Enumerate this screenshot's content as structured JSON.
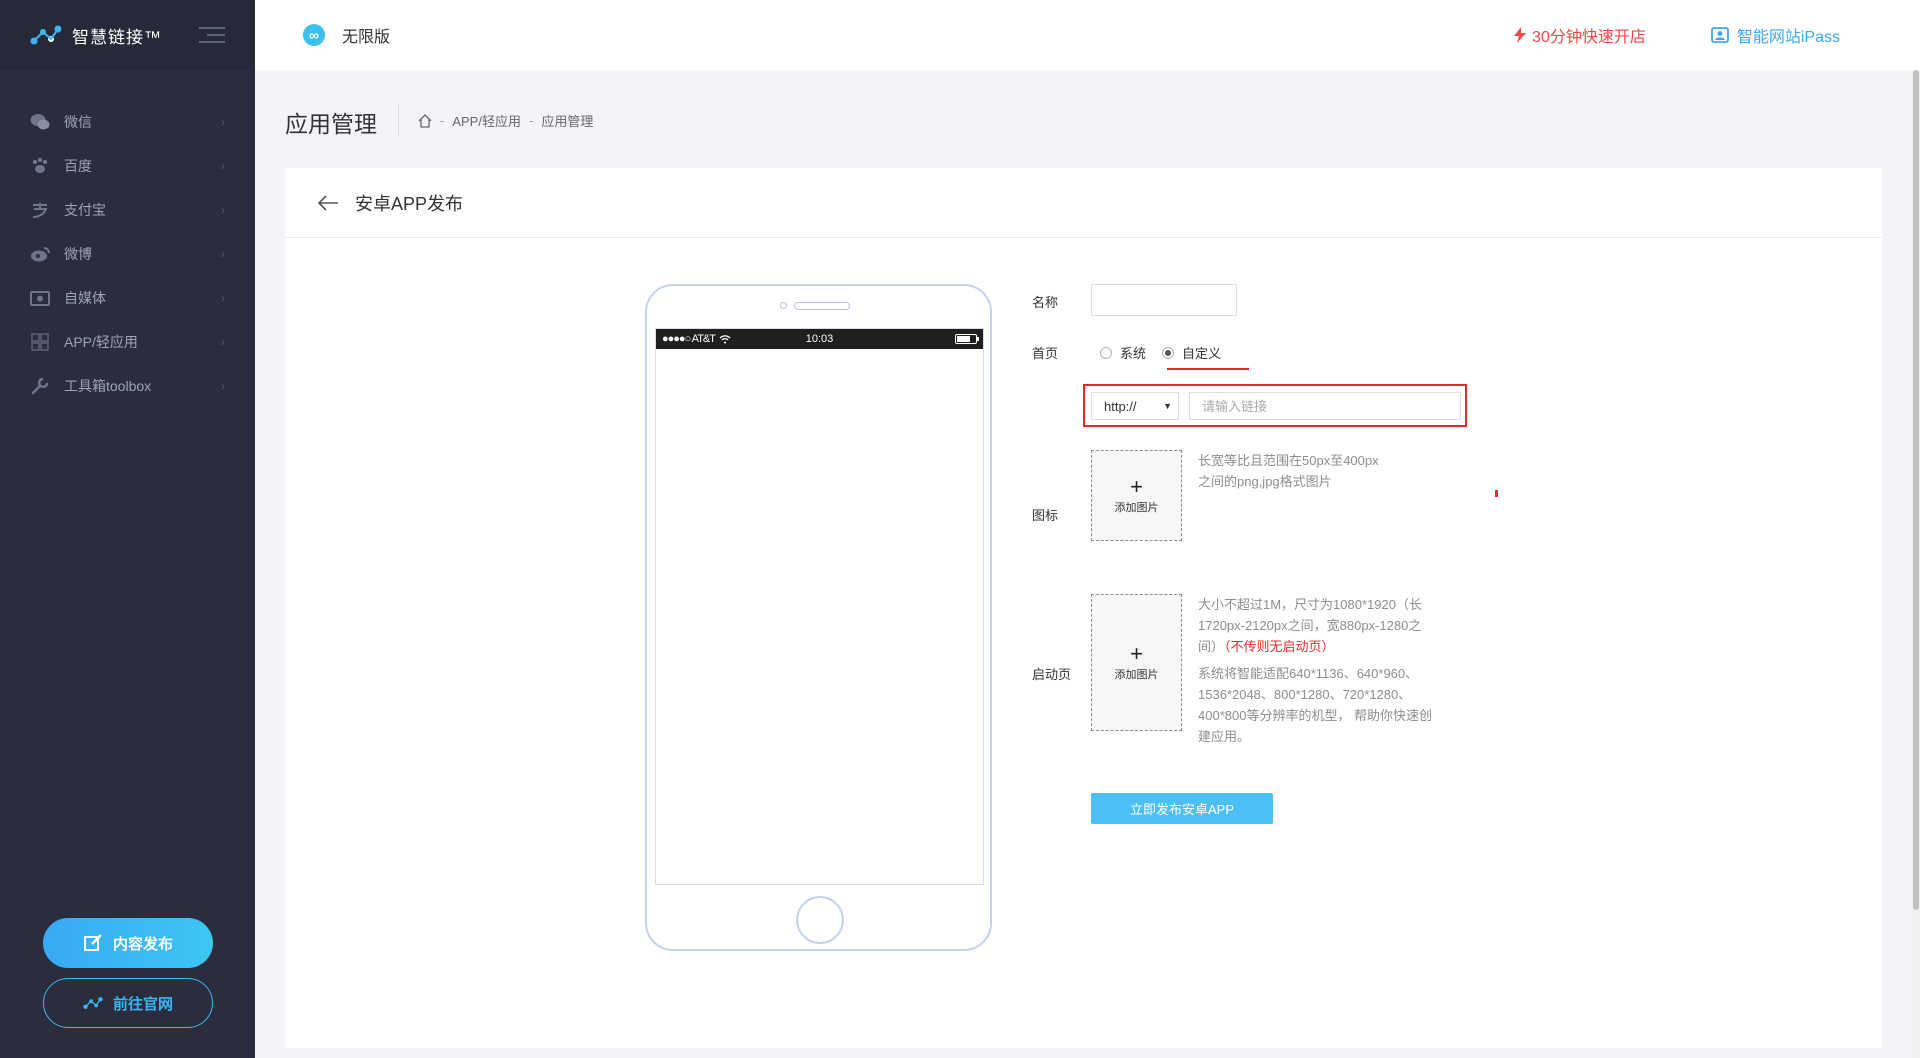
{
  "brand": {
    "name": "智慧链接™"
  },
  "sidebar": {
    "items": [
      {
        "label": "微信",
        "icon": "wechat-icon"
      },
      {
        "label": "百度",
        "icon": "paw-icon"
      },
      {
        "label": "支付宝",
        "icon": "alipay-icon"
      },
      {
        "label": "微博",
        "icon": "weibo-icon"
      },
      {
        "label": "自媒体",
        "icon": "media-icon"
      },
      {
        "label": "APP/轻应用",
        "icon": "app-grid-icon"
      },
      {
        "label": "工具箱toolbox",
        "icon": "wrench-icon"
      }
    ],
    "publish_button": "内容发布",
    "official_button": "前往官网"
  },
  "topbar": {
    "edition": "无限版",
    "promo": "30分钟快速开店",
    "ipass": "智能网站iPass"
  },
  "page": {
    "title": "应用管理",
    "breadcrumb": [
      "APP/轻应用",
      "应用管理"
    ]
  },
  "card": {
    "title": "安卓APP发布"
  },
  "phone": {
    "carrier": "●●●●○ AT&T",
    "time": "10:03"
  },
  "form": {
    "name_label": "名称",
    "home_label": "首页",
    "home_options": [
      "系统",
      "自定义"
    ],
    "home_selected": "自定义",
    "protocol": "http://",
    "link_placeholder": "请输入链接",
    "icon_label": "图标",
    "add_image": "添加图片",
    "icon_hint_1": "长宽等比且范围在50px至400px",
    "icon_hint_2": "之间的png,jpg格式图片",
    "splash_label": "启动页",
    "splash_hint_1": "大小不超过1M，尺寸为1080*1920（长",
    "splash_hint_2": "1720px-2120px之间，宽880px-1280之",
    "splash_hint_3": "间）",
    "splash_warn": "（不传则无启动页）",
    "splash_hint_4": "系统将智能适配640*1136、640*960、",
    "splash_hint_5": "1536*2048、800*1280、720*1280、",
    "splash_hint_6": "400*800等分辨率的机型， 帮助你快速创",
    "splash_hint_7": "建应用。",
    "publish_button": "立即发布安卓APP"
  },
  "colors": {
    "sidebar_bg": "#2a2d3e",
    "accent": "#3cb6f2",
    "danger": "#e8282d"
  }
}
